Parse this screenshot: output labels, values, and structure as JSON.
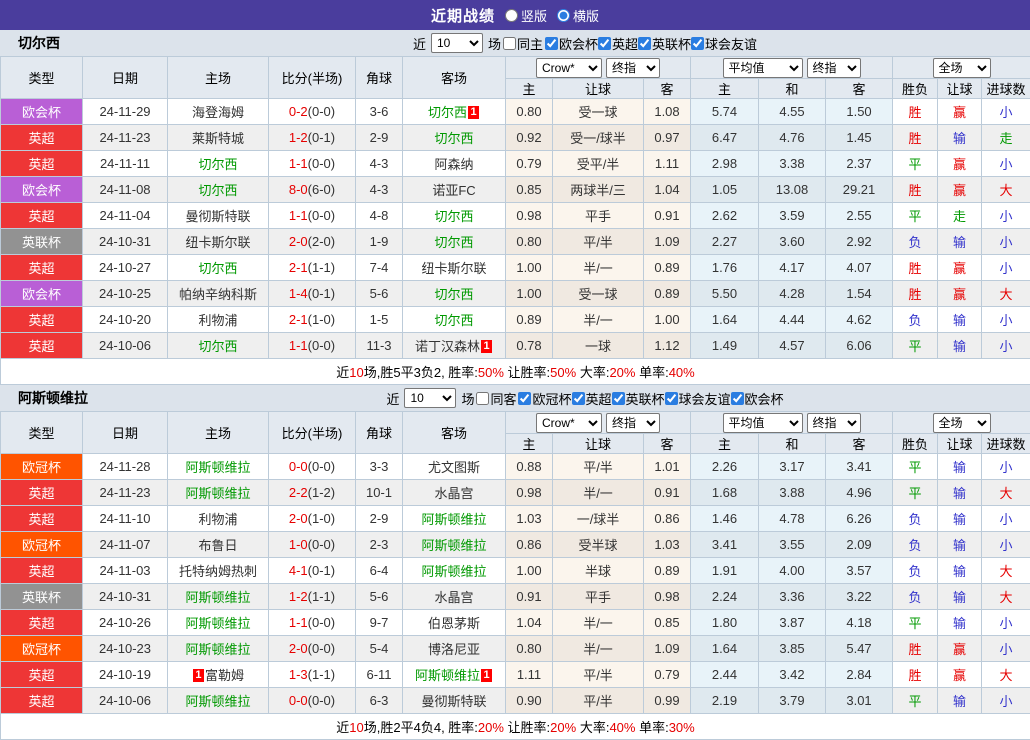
{
  "page": {
    "title": "近期战绩",
    "radio_vertical": "竖版",
    "radio_horizontal": "横版"
  },
  "table_common": {
    "near_label": "近",
    "games_count": "10",
    "games_suffix": "场",
    "col_headers": [
      "类型",
      "日期",
      "主场",
      "比分(半场)",
      "角球",
      "客场"
    ],
    "sub_odds": [
      "主",
      "让球",
      "客"
    ],
    "sub_avg": [
      "主",
      "和",
      "客"
    ],
    "sub_result": [
      "胜负",
      "让球",
      "进球数"
    ],
    "select_crow": "Crow*",
    "select_final": "终指",
    "select_avg": "平均值",
    "select_final2": "终指",
    "select_full": "全场"
  },
  "league_colors": {
    "欧会杯": "#b95fd6",
    "英超": "#ee3636",
    "英联杯": "#929292",
    "欧冠杯": "#ff5400"
  },
  "result_colors": {
    "red": "#e60000",
    "green": "#009900",
    "blue": "#3333cc"
  },
  "sections": [
    {
      "team": "切尔西",
      "same_label": "同主",
      "leagues": [
        "欧会杯",
        "英超",
        "英联杯",
        "球会友谊"
      ],
      "matches": [
        {
          "type": "欧会杯",
          "date": "24-11-29",
          "home": "海登海姆",
          "home_self": false,
          "home_rc": 0,
          "score": "0-2",
          "half": "(0-0)",
          "corner": "3-6",
          "away": "切尔西",
          "away_self": true,
          "away_rc": 1,
          "odds_home": "0.80",
          "handicap": "受一球",
          "odds_away": "1.08",
          "avg_home": "5.74",
          "avg_draw": "4.55",
          "avg_away": "1.50",
          "res_wdl": {
            "t": "胜",
            "c": "red"
          },
          "res_handicap": {
            "t": "赢",
            "c": "red"
          },
          "res_goals": {
            "t": "小",
            "c": "blue"
          }
        },
        {
          "type": "英超",
          "date": "24-11-23",
          "home": "莱斯特城",
          "home_self": false,
          "home_rc": 0,
          "score": "1-2",
          "half": "(0-1)",
          "corner": "2-9",
          "away": "切尔西",
          "away_self": true,
          "away_rc": 0,
          "odds_home": "0.92",
          "handicap": "受一/球半",
          "odds_away": "0.97",
          "avg_home": "6.47",
          "avg_draw": "4.76",
          "avg_away": "1.45",
          "res_wdl": {
            "t": "胜",
            "c": "red"
          },
          "res_handicap": {
            "t": "输",
            "c": "blue"
          },
          "res_goals": {
            "t": "走",
            "c": "green"
          }
        },
        {
          "type": "英超",
          "date": "24-11-11",
          "home": "切尔西",
          "home_self": true,
          "home_rc": 0,
          "score": "1-1",
          "half": "(0-0)",
          "corner": "4-3",
          "away": "阿森纳",
          "away_self": false,
          "away_rc": 0,
          "odds_home": "0.79",
          "handicap": "受平/半",
          "odds_away": "1.11",
          "avg_home": "2.98",
          "avg_draw": "3.38",
          "avg_away": "2.37",
          "res_wdl": {
            "t": "平",
            "c": "green"
          },
          "res_handicap": {
            "t": "赢",
            "c": "red"
          },
          "res_goals": {
            "t": "小",
            "c": "blue"
          }
        },
        {
          "type": "欧会杯",
          "date": "24-11-08",
          "home": "切尔西",
          "home_self": true,
          "home_rc": 0,
          "score": "8-0",
          "half": "(6-0)",
          "corner": "4-3",
          "away": "诺亚FC",
          "away_self": false,
          "away_rc": 0,
          "odds_home": "0.85",
          "handicap": "两球半/三",
          "odds_away": "1.04",
          "avg_home": "1.05",
          "avg_draw": "13.08",
          "avg_away": "29.21",
          "res_wdl": {
            "t": "胜",
            "c": "red"
          },
          "res_handicap": {
            "t": "赢",
            "c": "red"
          },
          "res_goals": {
            "t": "大",
            "c": "red"
          }
        },
        {
          "type": "英超",
          "date": "24-11-04",
          "home": "曼彻斯特联",
          "home_self": false,
          "home_rc": 0,
          "score": "1-1",
          "half": "(0-0)",
          "corner": "4-8",
          "away": "切尔西",
          "away_self": true,
          "away_rc": 0,
          "odds_home": "0.98",
          "handicap": "平手",
          "odds_away": "0.91",
          "avg_home": "2.62",
          "avg_draw": "3.59",
          "avg_away": "2.55",
          "res_wdl": {
            "t": "平",
            "c": "green"
          },
          "res_handicap": {
            "t": "走",
            "c": "green"
          },
          "res_goals": {
            "t": "小",
            "c": "blue"
          }
        },
        {
          "type": "英联杯",
          "date": "24-10-31",
          "home": "纽卡斯尔联",
          "home_self": false,
          "home_rc": 0,
          "score": "2-0",
          "half": "(2-0)",
          "corner": "1-9",
          "away": "切尔西",
          "away_self": true,
          "away_rc": 0,
          "odds_home": "0.80",
          "handicap": "平/半",
          "odds_away": "1.09",
          "avg_home": "2.27",
          "avg_draw": "3.60",
          "avg_away": "2.92",
          "res_wdl": {
            "t": "负",
            "c": "blue"
          },
          "res_handicap": {
            "t": "输",
            "c": "blue"
          },
          "res_goals": {
            "t": "小",
            "c": "blue"
          }
        },
        {
          "type": "英超",
          "date": "24-10-27",
          "home": "切尔西",
          "home_self": true,
          "home_rc": 0,
          "score": "2-1",
          "half": "(1-1)",
          "corner": "7-4",
          "away": "纽卡斯尔联",
          "away_self": false,
          "away_rc": 0,
          "odds_home": "1.00",
          "handicap": "半/一",
          "odds_away": "0.89",
          "avg_home": "1.76",
          "avg_draw": "4.17",
          "avg_away": "4.07",
          "res_wdl": {
            "t": "胜",
            "c": "red"
          },
          "res_handicap": {
            "t": "赢",
            "c": "red"
          },
          "res_goals": {
            "t": "小",
            "c": "blue"
          }
        },
        {
          "type": "欧会杯",
          "date": "24-10-25",
          "home": "帕纳辛纳科斯",
          "home_self": false,
          "home_rc": 0,
          "score": "1-4",
          "half": "(0-1)",
          "corner": "5-6",
          "away": "切尔西",
          "away_self": true,
          "away_rc": 0,
          "odds_home": "1.00",
          "handicap": "受一球",
          "odds_away": "0.89",
          "avg_home": "5.50",
          "avg_draw": "4.28",
          "avg_away": "1.54",
          "res_wdl": {
            "t": "胜",
            "c": "red"
          },
          "res_handicap": {
            "t": "赢",
            "c": "red"
          },
          "res_goals": {
            "t": "大",
            "c": "red"
          }
        },
        {
          "type": "英超",
          "date": "24-10-20",
          "home": "利物浦",
          "home_self": false,
          "home_rc": 0,
          "score": "2-1",
          "half": "(1-0)",
          "corner": "1-5",
          "away": "切尔西",
          "away_self": true,
          "away_rc": 0,
          "odds_home": "0.89",
          "handicap": "半/一",
          "odds_away": "1.00",
          "avg_home": "1.64",
          "avg_draw": "4.44",
          "avg_away": "4.62",
          "res_wdl": {
            "t": "负",
            "c": "blue"
          },
          "res_handicap": {
            "t": "输",
            "c": "blue"
          },
          "res_goals": {
            "t": "小",
            "c": "blue"
          }
        },
        {
          "type": "英超",
          "date": "24-10-06",
          "home": "切尔西",
          "home_self": true,
          "home_rc": 0,
          "score": "1-1",
          "half": "(0-0)",
          "corner": "11-3",
          "away": "诺丁汉森林",
          "away_self": false,
          "away_rc": 1,
          "odds_home": "0.78",
          "handicap": "一球",
          "odds_away": "1.12",
          "avg_home": "1.49",
          "avg_draw": "4.57",
          "avg_away": "6.06",
          "res_wdl": {
            "t": "平",
            "c": "green"
          },
          "res_handicap": {
            "t": "输",
            "c": "blue"
          },
          "res_goals": {
            "t": "小",
            "c": "blue"
          }
        }
      ],
      "summary": [
        {
          "t": "近",
          "red": false
        },
        {
          "t": "10",
          "red": true
        },
        {
          "t": "场,胜5平3负2, 胜率:",
          "red": false
        },
        {
          "t": "50%",
          "red": true
        },
        {
          "t": " 让胜率:",
          "red": false
        },
        {
          "t": "50%",
          "red": true
        },
        {
          "t": " 大率:",
          "red": false
        },
        {
          "t": "20%",
          "red": true
        },
        {
          "t": " 单率:",
          "red": false
        },
        {
          "t": "40%",
          "red": true
        }
      ]
    },
    {
      "team": "阿斯顿维拉",
      "same_label": "同客",
      "leagues": [
        "欧冠杯",
        "英超",
        "英联杯",
        "球会友谊",
        "欧会杯"
      ],
      "matches": [
        {
          "type": "欧冠杯",
          "date": "24-11-28",
          "home": "阿斯顿维拉",
          "home_self": true,
          "home_rc": 0,
          "score": "0-0",
          "half": "(0-0)",
          "corner": "3-3",
          "away": "尤文图斯",
          "away_self": false,
          "away_rc": 0,
          "odds_home": "0.88",
          "handicap": "平/半",
          "odds_away": "1.01",
          "avg_home": "2.26",
          "avg_draw": "3.17",
          "avg_away": "3.41",
          "res_wdl": {
            "t": "平",
            "c": "green"
          },
          "res_handicap": {
            "t": "输",
            "c": "blue"
          },
          "res_goals": {
            "t": "小",
            "c": "blue"
          }
        },
        {
          "type": "英超",
          "date": "24-11-23",
          "home": "阿斯顿维拉",
          "home_self": true,
          "home_rc": 0,
          "score": "2-2",
          "half": "(1-2)",
          "corner": "10-1",
          "away": "水晶宫",
          "away_self": false,
          "away_rc": 0,
          "odds_home": "0.98",
          "handicap": "半/一",
          "odds_away": "0.91",
          "avg_home": "1.68",
          "avg_draw": "3.88",
          "avg_away": "4.96",
          "res_wdl": {
            "t": "平",
            "c": "green"
          },
          "res_handicap": {
            "t": "输",
            "c": "blue"
          },
          "res_goals": {
            "t": "大",
            "c": "red"
          }
        },
        {
          "type": "英超",
          "date": "24-11-10",
          "home": "利物浦",
          "home_self": false,
          "home_rc": 0,
          "score": "2-0",
          "half": "(1-0)",
          "corner": "2-9",
          "away": "阿斯顿维拉",
          "away_self": true,
          "away_rc": 0,
          "odds_home": "1.03",
          "handicap": "一/球半",
          "odds_away": "0.86",
          "avg_home": "1.46",
          "avg_draw": "4.78",
          "avg_away": "6.26",
          "res_wdl": {
            "t": "负",
            "c": "blue"
          },
          "res_handicap": {
            "t": "输",
            "c": "blue"
          },
          "res_goals": {
            "t": "小",
            "c": "blue"
          }
        },
        {
          "type": "欧冠杯",
          "date": "24-11-07",
          "home": "布鲁日",
          "home_self": false,
          "home_rc": 0,
          "score": "1-0",
          "half": "(0-0)",
          "corner": "2-3",
          "away": "阿斯顿维拉",
          "away_self": true,
          "away_rc": 0,
          "odds_home": "0.86",
          "handicap": "受半球",
          "odds_away": "1.03",
          "avg_home": "3.41",
          "avg_draw": "3.55",
          "avg_away": "2.09",
          "res_wdl": {
            "t": "负",
            "c": "blue"
          },
          "res_handicap": {
            "t": "输",
            "c": "blue"
          },
          "res_goals": {
            "t": "小",
            "c": "blue"
          }
        },
        {
          "type": "英超",
          "date": "24-11-03",
          "home": "托特纳姆热刺",
          "home_self": false,
          "home_rc": 0,
          "score": "4-1",
          "half": "(0-1)",
          "corner": "6-4",
          "away": "阿斯顿维拉",
          "away_self": true,
          "away_rc": 0,
          "odds_home": "1.00",
          "handicap": "半球",
          "odds_away": "0.89",
          "avg_home": "1.91",
          "avg_draw": "4.00",
          "avg_away": "3.57",
          "res_wdl": {
            "t": "负",
            "c": "blue"
          },
          "res_handicap": {
            "t": "输",
            "c": "blue"
          },
          "res_goals": {
            "t": "大",
            "c": "red"
          }
        },
        {
          "type": "英联杯",
          "date": "24-10-31",
          "home": "阿斯顿维拉",
          "home_self": true,
          "home_rc": 0,
          "score": "1-2",
          "half": "(1-1)",
          "corner": "5-6",
          "away": "水晶宫",
          "away_self": false,
          "away_rc": 0,
          "odds_home": "0.91",
          "handicap": "平手",
          "odds_away": "0.98",
          "avg_home": "2.24",
          "avg_draw": "3.36",
          "avg_away": "3.22",
          "res_wdl": {
            "t": "负",
            "c": "blue"
          },
          "res_handicap": {
            "t": "输",
            "c": "blue"
          },
          "res_goals": {
            "t": "大",
            "c": "red"
          }
        },
        {
          "type": "英超",
          "date": "24-10-26",
          "home": "阿斯顿维拉",
          "home_self": true,
          "home_rc": 0,
          "score": "1-1",
          "half": "(0-0)",
          "corner": "9-7",
          "away": "伯恩茅斯",
          "away_self": false,
          "away_rc": 0,
          "odds_home": "1.04",
          "handicap": "半/一",
          "odds_away": "0.85",
          "avg_home": "1.80",
          "avg_draw": "3.87",
          "avg_away": "4.18",
          "res_wdl": {
            "t": "平",
            "c": "green"
          },
          "res_handicap": {
            "t": "输",
            "c": "blue"
          },
          "res_goals": {
            "t": "小",
            "c": "blue"
          }
        },
        {
          "type": "欧冠杯",
          "date": "24-10-23",
          "home": "阿斯顿维拉",
          "home_self": true,
          "home_rc": 0,
          "score": "2-0",
          "half": "(0-0)",
          "corner": "5-4",
          "away": "博洛尼亚",
          "away_self": false,
          "away_rc": 0,
          "odds_home": "0.80",
          "handicap": "半/一",
          "odds_away": "1.09",
          "avg_home": "1.64",
          "avg_draw": "3.85",
          "avg_away": "5.47",
          "res_wdl": {
            "t": "胜",
            "c": "red"
          },
          "res_handicap": {
            "t": "赢",
            "c": "red"
          },
          "res_goals": {
            "t": "小",
            "c": "blue"
          }
        },
        {
          "type": "英超",
          "date": "24-10-19",
          "home": "富勒姆",
          "home_self": false,
          "home_rc": 1,
          "score": "1-3",
          "half": "(1-1)",
          "corner": "6-11",
          "away": "阿斯顿维拉",
          "away_self": true,
          "away_rc": 1,
          "odds_home": "1.11",
          "handicap": "平/半",
          "odds_away": "0.79",
          "avg_home": "2.44",
          "avg_draw": "3.42",
          "avg_away": "2.84",
          "res_wdl": {
            "t": "胜",
            "c": "red"
          },
          "res_handicap": {
            "t": "赢",
            "c": "red"
          },
          "res_goals": {
            "t": "大",
            "c": "red"
          }
        },
        {
          "type": "英超",
          "date": "24-10-06",
          "home": "阿斯顿维拉",
          "home_self": true,
          "home_rc": 0,
          "score": "0-0",
          "half": "(0-0)",
          "corner": "6-3",
          "away": "曼彻斯特联",
          "away_self": false,
          "away_rc": 0,
          "odds_home": "0.90",
          "handicap": "平/半",
          "odds_away": "0.99",
          "avg_home": "2.19",
          "avg_draw": "3.79",
          "avg_away": "3.01",
          "res_wdl": {
            "t": "平",
            "c": "green"
          },
          "res_handicap": {
            "t": "输",
            "c": "blue"
          },
          "res_goals": {
            "t": "小",
            "c": "blue"
          }
        }
      ],
      "summary": [
        {
          "t": "近",
          "red": false
        },
        {
          "t": "10",
          "red": true
        },
        {
          "t": "场,胜2平4负4, 胜率:",
          "red": false
        },
        {
          "t": "20%",
          "red": true
        },
        {
          "t": " 让胜率:",
          "red": false
        },
        {
          "t": "20%",
          "red": true
        },
        {
          "t": " 大率:",
          "red": false
        },
        {
          "t": "40%",
          "red": true
        },
        {
          "t": " 单率:",
          "red": false
        },
        {
          "t": "30%",
          "red": true
        }
      ]
    }
  ]
}
